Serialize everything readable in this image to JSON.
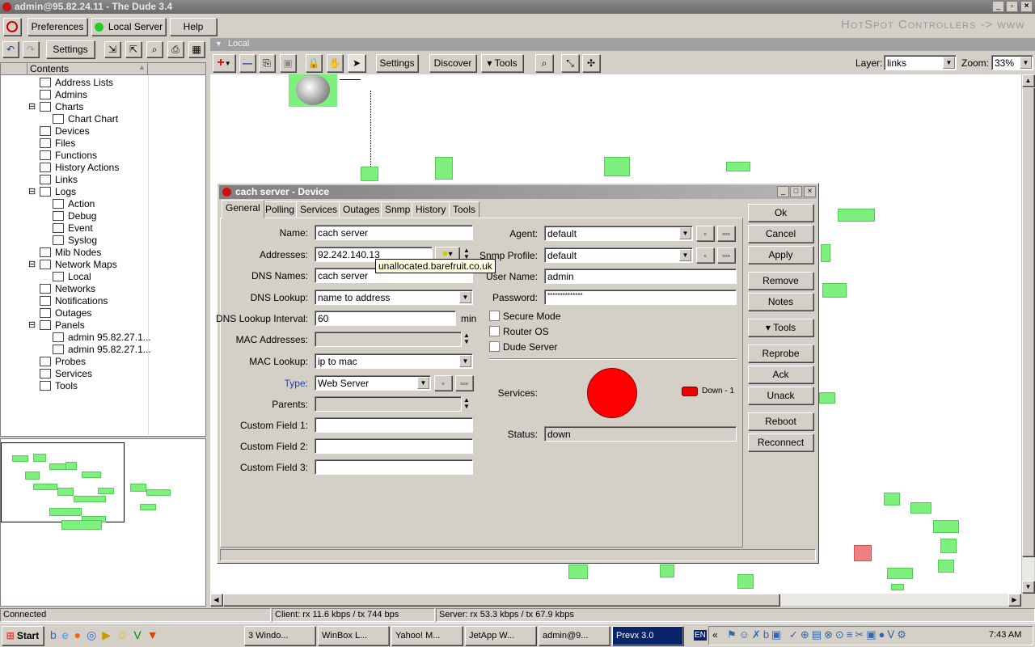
{
  "window": {
    "title": "admin@95.82.24.11 - The Dude 3.4",
    "banner": "HotSpot Controllers -> www"
  },
  "main_toolbar": {
    "preferences": "Preferences",
    "local_server": "Local Server",
    "help": "Help"
  },
  "left_toolbar": {
    "settings": "Settings"
  },
  "tree": {
    "header": "Contents",
    "items": [
      {
        "label": "Address Lists",
        "level": 1
      },
      {
        "label": "Admins",
        "level": 1
      },
      {
        "label": "Charts",
        "level": 1,
        "expand": "-"
      },
      {
        "label": "Chart Chart",
        "level": 2
      },
      {
        "label": "Devices",
        "level": 1
      },
      {
        "label": "Files",
        "level": 1
      },
      {
        "label": "Functions",
        "level": 1
      },
      {
        "label": "History Actions",
        "level": 1
      },
      {
        "label": "Links",
        "level": 1
      },
      {
        "label": "Logs",
        "level": 1,
        "expand": "-"
      },
      {
        "label": "Action",
        "level": 2
      },
      {
        "label": "Debug",
        "level": 2
      },
      {
        "label": "Event",
        "level": 2
      },
      {
        "label": "Syslog",
        "level": 2
      },
      {
        "label": "Mib Nodes",
        "level": 1
      },
      {
        "label": "Network Maps",
        "level": 1,
        "expand": "-"
      },
      {
        "label": "Local",
        "level": 2
      },
      {
        "label": "Networks",
        "level": 1
      },
      {
        "label": "Notifications",
        "level": 1
      },
      {
        "label": "Outages",
        "level": 1
      },
      {
        "label": "Panels",
        "level": 1,
        "expand": "-"
      },
      {
        "label": "admin 95.82.27.1...",
        "level": 2
      },
      {
        "label": "admin 95.82.27.1...",
        "level": 2
      },
      {
        "label": "Probes",
        "level": 1
      },
      {
        "label": "Services",
        "level": 1
      },
      {
        "label": "Tools",
        "level": 1
      }
    ]
  },
  "map": {
    "title": "Local",
    "settings": "Settings",
    "discover": "Discover",
    "tools": "Tools",
    "layer_label": "Layer:",
    "layer_value": "links",
    "zoom_label": "Zoom:",
    "zoom_value": "33%"
  },
  "dialog": {
    "title": "cach server - Device",
    "tabs": [
      "General",
      "Polling",
      "Services",
      "Outages",
      "Snmp",
      "History",
      "Tools"
    ],
    "active_tab": "General",
    "name_label": "Name:",
    "name": "cach server",
    "addresses_label": "Addresses:",
    "addresses": "92.242.140.13",
    "tooltip": "unallocated.barefruit.co.uk",
    "dns_names_label": "DNS Names:",
    "dns_names": "cach server",
    "dns_lookup_label": "DNS Lookup:",
    "dns_lookup": "name to address",
    "dns_interval_label": "DNS Lookup Interval:",
    "dns_interval": "60",
    "dns_interval_unit": "min",
    "mac_addresses_label": "MAC Addresses:",
    "mac_addresses": "",
    "mac_lookup_label": "MAC Lookup:",
    "mac_lookup": "ip to mac",
    "type_label": "Type:",
    "type": "Web Server",
    "parents_label": "Parents:",
    "parents": "",
    "custom1_label": "Custom Field 1:",
    "custom2_label": "Custom Field 2:",
    "custom3_label": "Custom Field 3:",
    "agent_label": "Agent:",
    "agent": "default",
    "snmp_profile_label": "Snmp Profile:",
    "snmp_profile": "default",
    "user_label": "User Name:",
    "user": "admin",
    "password_label": "Password:",
    "password": "**************",
    "secure_mode": "Secure Mode",
    "router_os": "Router OS",
    "dude_server": "Dude Server",
    "services_label": "Services:",
    "service_legend": "Down - 1",
    "service_color": "#ff0000",
    "status_label": "Status:",
    "status": "down",
    "buttons": {
      "ok": "Ok",
      "cancel": "Cancel",
      "apply": "Apply",
      "remove": "Remove",
      "notes": "Notes",
      "tools": "Tools",
      "reprobe": "Reprobe",
      "ack": "Ack",
      "unack": "Unack",
      "reboot": "Reboot",
      "reconnect": "Reconnect"
    }
  },
  "statusbar": {
    "connection": "Connected",
    "client": "Client: rx 11.6 kbps / tx 744 bps",
    "server": "Server: rx 53.3 kbps / tx 67.9 kbps"
  },
  "taskbar": {
    "start": "Start",
    "tasks": [
      "3 Windo...",
      "WinBox L...",
      "Yahoo! M...",
      "JetApp W...",
      "admin@9...",
      "Prevx 3.0"
    ],
    "active_task": "Prevx 3.0",
    "lang": "EN",
    "clock": "7:43 AM"
  }
}
